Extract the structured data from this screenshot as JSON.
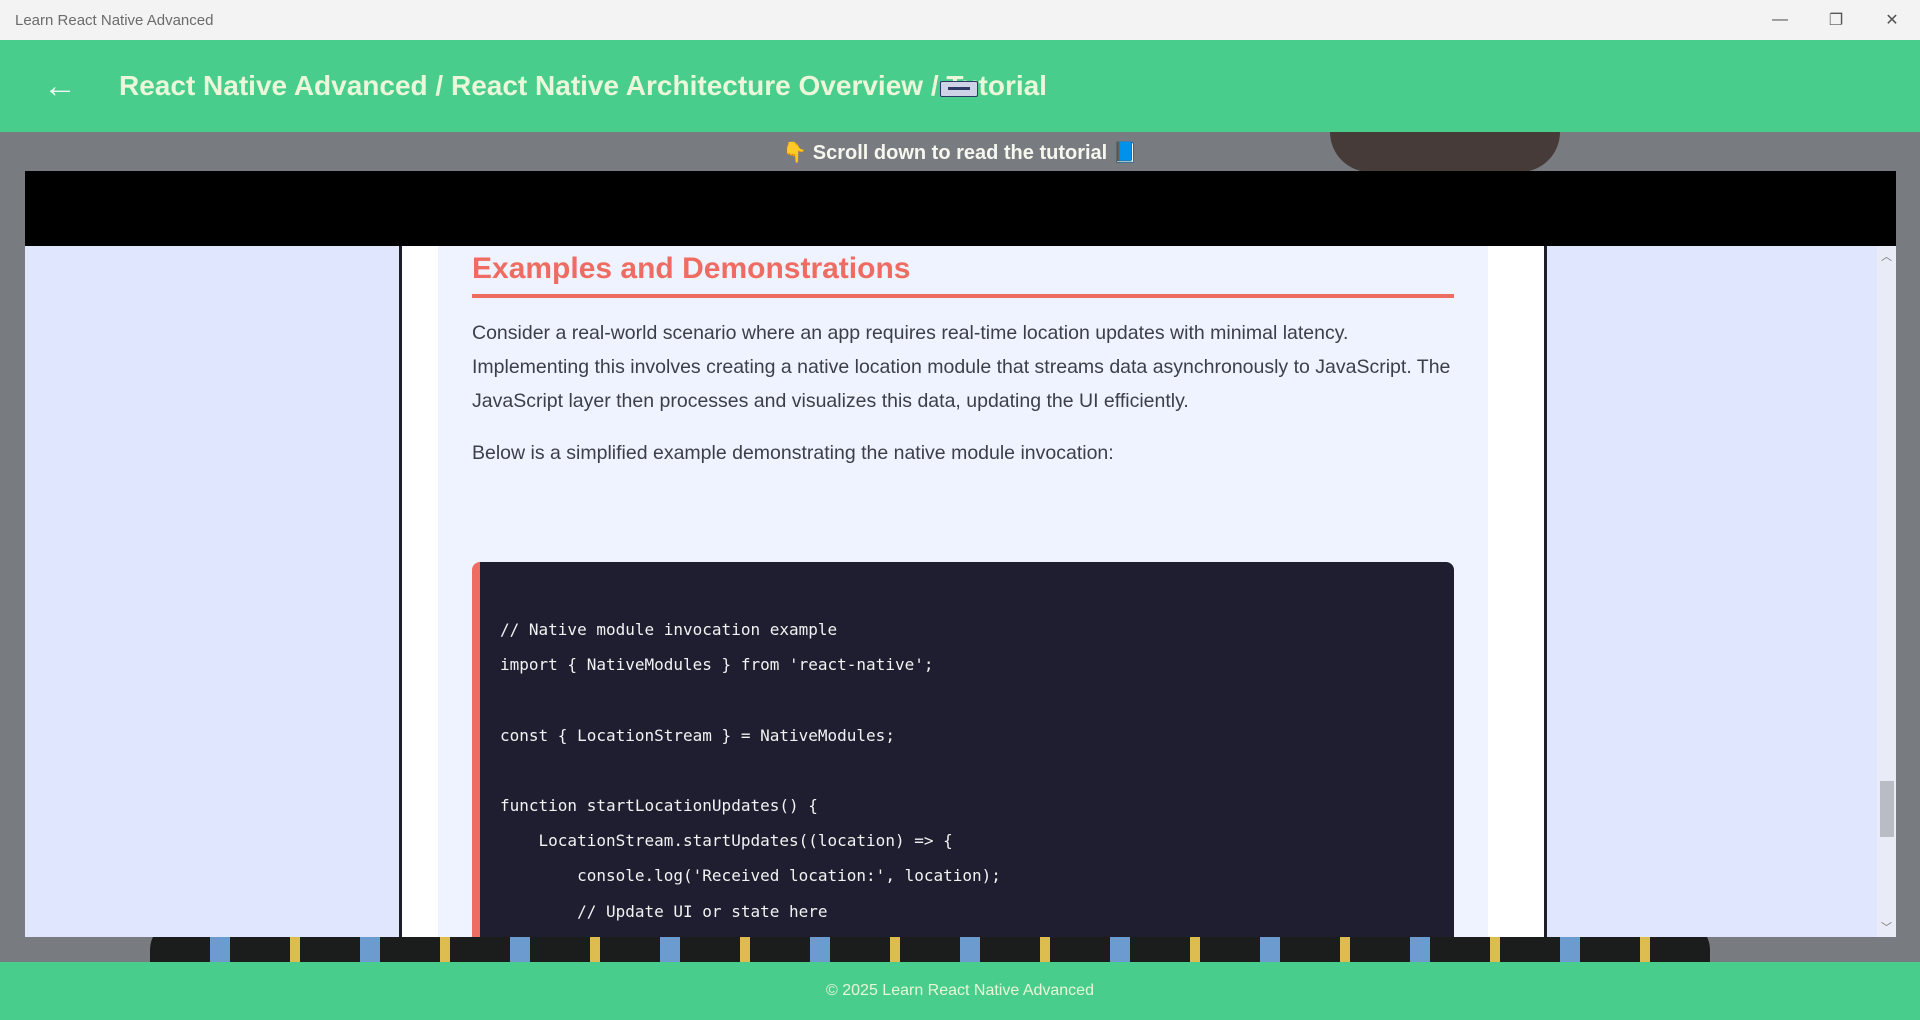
{
  "window": {
    "title": "Learn React Native Advanced",
    "controls": {
      "minimize": "—",
      "restore": "❐",
      "close": "✕"
    }
  },
  "header": {
    "back_icon": "←",
    "breadcrumb": "React Native Advanced / React Native Architecture Overview / Tutorial"
  },
  "scroll_hint": "👇 Scroll down to read the tutorial 📘",
  "article": {
    "section_title": "Examples and Demonstrations",
    "paragraph_1": "Consider a real-world scenario where an app requires real-time location updates with minimal latency. Implementing this involves creating a native location module that streams data asynchronously to JavaScript. The JavaScript layer then processes and visualizes this data, updating the UI efficiently.",
    "paragraph_2": "Below is a simplified example demonstrating the native module invocation:",
    "code_lines": [
      "// Native module invocation example",
      "import { NativeModules } from 'react-native';",
      "",
      "const { LocationStream } = NativeModules;",
      "",
      "function startLocationUpdates() {",
      "    LocationStream.startUpdates((location) => {",
      "        console.log('Received location:', location);",
      "        // Update UI or state here",
      "    });",
      "}"
    ]
  },
  "scrollbar": {
    "up_arrow": "︿",
    "down_arrow": "﹀"
  },
  "footer": {
    "text": "© 2025 Learn React Native Advanced"
  },
  "colors": {
    "accent_green": "#48cd8c",
    "heading_coral": "#ef6c62",
    "code_bg": "#1f1e30"
  }
}
